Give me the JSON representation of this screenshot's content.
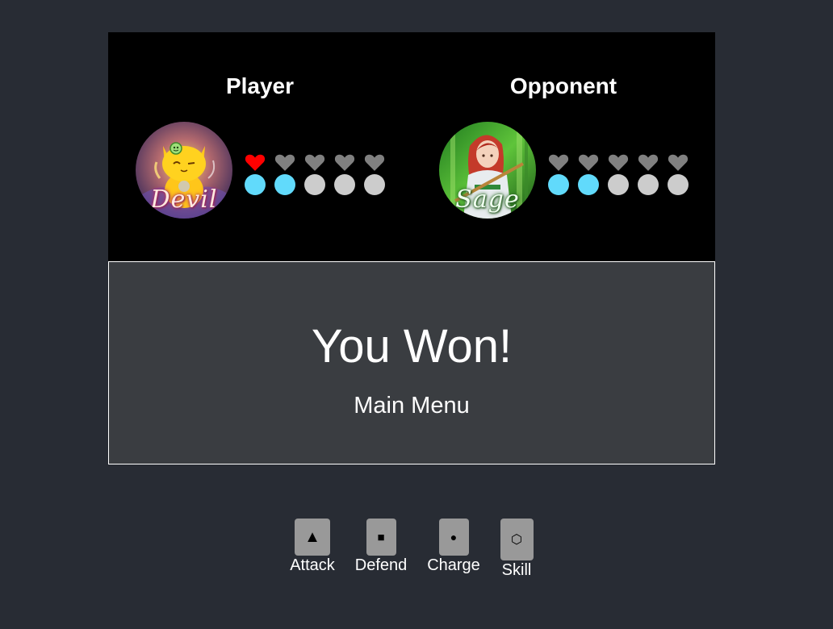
{
  "player": {
    "title": "Player",
    "character_name": "Devil",
    "health": 1,
    "health_max": 5,
    "energy": 2,
    "energy_max": 5
  },
  "opponent": {
    "title": "Opponent",
    "character_name": "Sage",
    "health": 0,
    "health_max": 5,
    "energy": 2,
    "energy_max": 5
  },
  "colors": {
    "heart_full": "#ff0000",
    "heart_empty": "#808080",
    "energy_full": "#61dafb",
    "energy_empty": "#cccccc"
  },
  "result": {
    "title": "You Won!",
    "main_menu_label": "Main Menu"
  },
  "actions": [
    {
      "icon": "▲",
      "label": "Attack"
    },
    {
      "icon": "■",
      "label": "Defend"
    },
    {
      "icon": "●",
      "label": "Charge"
    },
    {
      "icon": "⬡",
      "label": "Skill"
    }
  ]
}
